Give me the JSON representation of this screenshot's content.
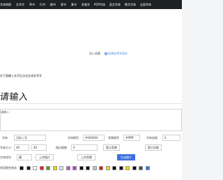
{
  "nav": {
    "items": [
      "字体转换",
      "艺术字",
      "草书",
      "行书",
      "楷书",
      "隶书",
      "篆书",
      "毛笔字",
      "POP字体",
      "英文字体",
      "数字字体",
      "全部字体"
    ]
  },
  "hero": {
    "designer_label": "加入收藏",
    "designer_link": "在线艺术字设计"
  },
  "editor": {
    "instruction": "在下面输入文字后点击生成艺术字",
    "preview_text": "请输入",
    "textarea_placeholder": "请输入："
  },
  "form": {
    "font_label": "字体",
    "font_value": "汉标三号",
    "font_color_label": "字体颜色",
    "font_color_value": "#000000",
    "bg_color_label": "背景颜色",
    "bg_color_value": "#ffffff",
    "font_spacing_label": "字体加粗",
    "font_spacing_value": "0",
    "size_label": "字体大小",
    "size_value": "40",
    "size_value2": "40",
    "wrap_label": "描边粗细",
    "wrap_value": "0",
    "effect_label": "提示背景",
    "effect_value": "提示风格",
    "direction_label": "字体排列",
    "direction_value": "横",
    "upload_label": "上传图片",
    "upload_bg_label": "上传背景",
    "generate_label": "生成图片",
    "palette_label": "常用颜色挑选"
  },
  "colors": [
    "#000000",
    "#1a1a1a",
    "#ffffff",
    "#e01b1b",
    "#5a9c2a",
    "#f5d400",
    "#e6e6e6",
    "#d94db5",
    "#a83ff0",
    "#000000",
    "#000000",
    "#c2c2c2",
    "#cc2222",
    "#f5d400",
    "#000000",
    "#000000",
    "#f5d400",
    "#000000",
    "#4a4a4a",
    "#2a7bd8"
  ]
}
